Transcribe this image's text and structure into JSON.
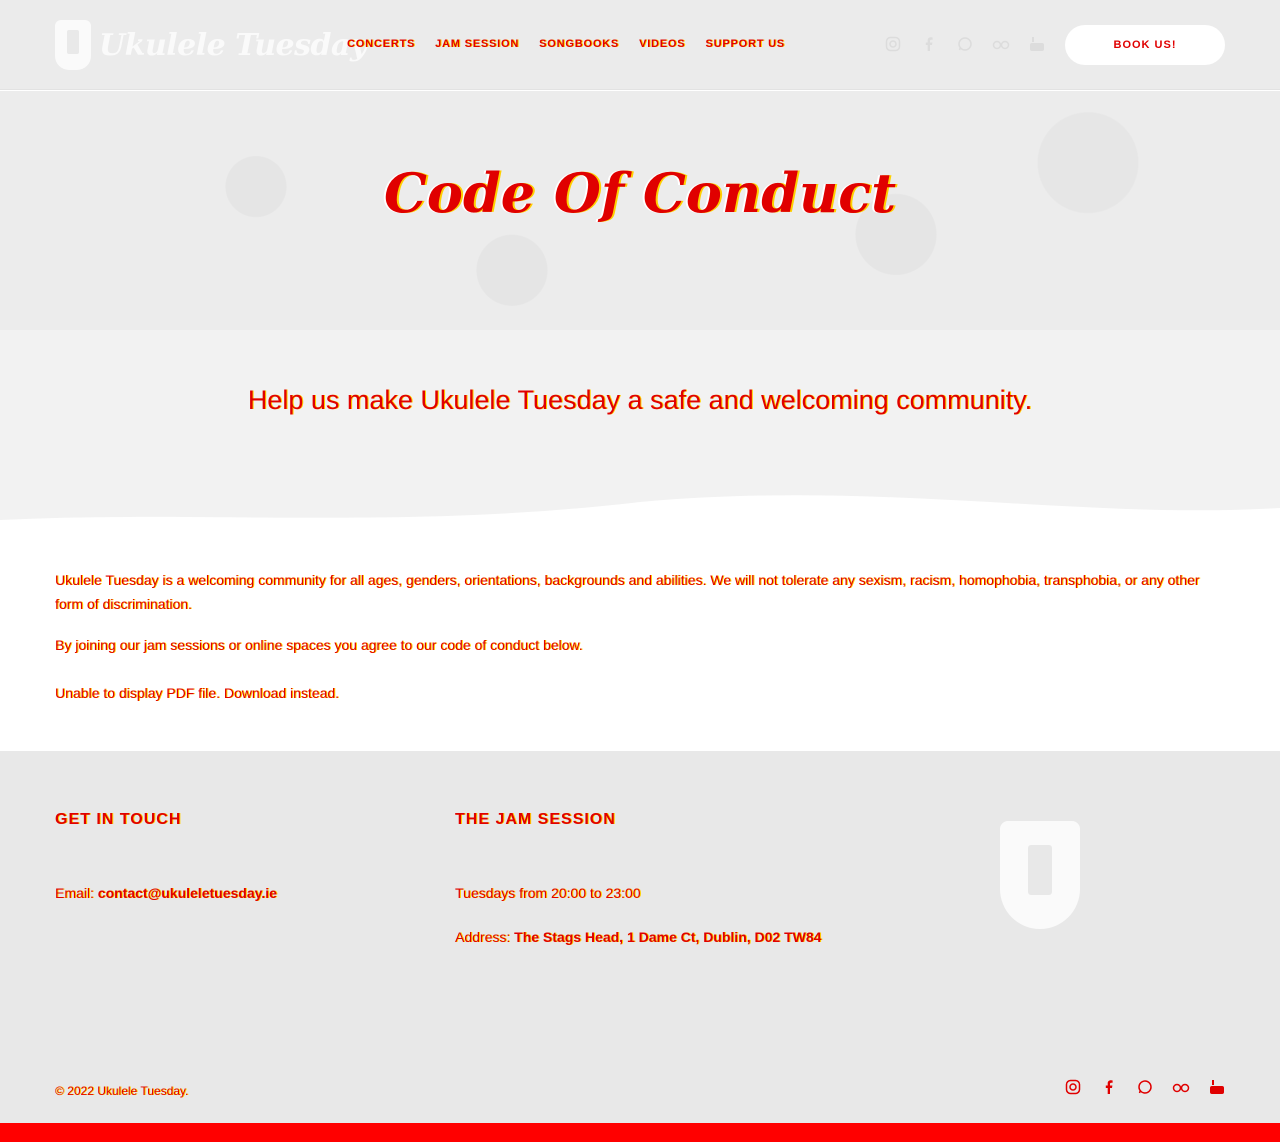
{
  "header": {
    "brand": "Ukulele Tuesday",
    "nav": [
      "CONCERTS",
      "JAM SESSION",
      "SONGBOOKS",
      "VIDEOS",
      "SUPPORT US"
    ],
    "social_icons": [
      "instagram-icon",
      "facebook-icon",
      "whatsapp-icon",
      "tripadvisor-icon",
      "youtube-icon"
    ],
    "book_label": "BOOK US!"
  },
  "hero": {
    "title": "Code Of Conduct"
  },
  "intro": {
    "text": "Help us make Ukulele Tuesday a safe and welcoming community."
  },
  "content": {
    "paragraph1": "Ukulele Tuesday is a welcoming community for all ages, genders, orientations, backgrounds and abilities. We will not tolerate any sexism, racism, homophobia, transphobia, or any other form of discrimination.",
    "paragraph2": "By joining our jam sessions or online spaces you agree to our code of conduct below.",
    "pdf_fallback": "Unable to display PDF file. Download instead."
  },
  "footer": {
    "col1_heading": "GET IN TOUCH",
    "email_label": "Email: ",
    "email": "contact@ukuleletuesday.ie",
    "col2_heading": "THE JAM SESSION",
    "schedule": "Tuesdays from 20:00 to 23:00",
    "address_label": "Address: ",
    "address": "The Stags Head, 1 Dame Ct, Dublin, D02 TW84",
    "copyright": "© 2022 Ukulele Tuesday.",
    "social_icons": [
      "instagram-icon",
      "facebook-icon",
      "whatsapp-icon",
      "tripadvisor-icon",
      "youtube-icon"
    ]
  },
  "colors": {
    "accent": "#e00000",
    "shadow": "#ffd000",
    "header_bg": "#ebebeb",
    "footer_bg": "#e8e8e8",
    "bottom_bar": "#ff0000"
  }
}
